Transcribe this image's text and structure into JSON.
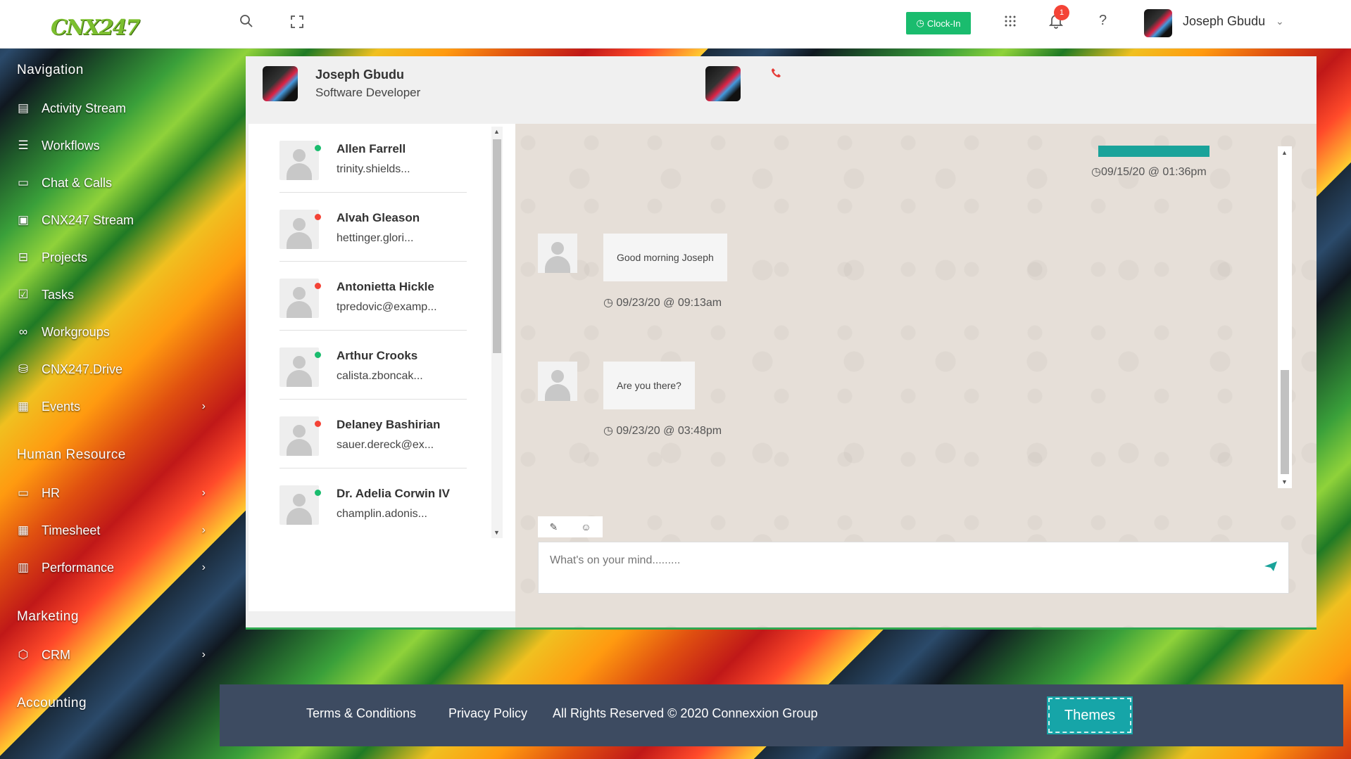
{
  "topbar": {
    "logo": "CNX247",
    "clockin_label": "Clock-In",
    "notification_count": "1",
    "help": "?",
    "user_name": "Joseph Gbudu"
  },
  "sidebar": {
    "sections": {
      "navigation": "Navigation",
      "hr": "Human Resource",
      "marketing": "Marketing",
      "accounting": "Accounting"
    },
    "items": [
      {
        "label": "Activity Stream",
        "icon": "activity-icon"
      },
      {
        "label": "Workflows",
        "icon": "menu-icon"
      },
      {
        "label": "Chat & Calls",
        "icon": "chat-icon"
      },
      {
        "label": "CNX247 Stream",
        "icon": "video-icon"
      },
      {
        "label": "Projects",
        "icon": "briefcase-icon"
      },
      {
        "label": "Tasks",
        "icon": "checkbox-icon"
      },
      {
        "label": "Workgroups",
        "icon": "group-icon"
      },
      {
        "label": "CNX247.Drive",
        "icon": "drive-icon"
      },
      {
        "label": "Events",
        "icon": "calendar-icon"
      },
      {
        "label": "HR",
        "icon": "id-card-icon"
      },
      {
        "label": "Timesheet",
        "icon": "calendar-icon"
      },
      {
        "label": "Performance",
        "icon": "bar-chart-icon"
      },
      {
        "label": "CRM",
        "icon": "cube-icon"
      }
    ]
  },
  "chat_header": {
    "name": "Joseph Gbudu",
    "role": "Software Developer"
  },
  "contacts": [
    {
      "name": "Allen Farrell",
      "email": "trinity.shields...",
      "status": "online"
    },
    {
      "name": "Alvah Gleason",
      "email": "hettinger.glori...",
      "status": "offline"
    },
    {
      "name": "Antonietta Hickle",
      "email": "tpredovic@examp...",
      "status": "offline"
    },
    {
      "name": "Arthur Crooks",
      "email": "calista.zboncak...",
      "status": "online"
    },
    {
      "name": "Delaney Bashirian",
      "email": "sauer.dereck@ex...",
      "status": "offline"
    },
    {
      "name": "Dr. Adelia Corwin IV",
      "email": "champlin.adonis...",
      "status": "online"
    }
  ],
  "messages": {
    "sent_timestamp": "09/15/20 @ 01:36pm",
    "received": [
      {
        "text": "Good morning Joseph",
        "timestamp": "09/23/20 @ 09:13am"
      },
      {
        "text": "Are you there?",
        "timestamp": "09/23/20 @ 03:48pm"
      }
    ]
  },
  "composer": {
    "placeholder": "What's on your mind........."
  },
  "footer": {
    "terms": "Terms & Conditions",
    "privacy": "Privacy Policy",
    "copyright": "All Rights Reserved © 2020 Connexxion Group",
    "themes": "Themes"
  },
  "colors": {
    "online": "#1abc6e",
    "offline": "#f44336",
    "accent": "#1aa39a"
  }
}
